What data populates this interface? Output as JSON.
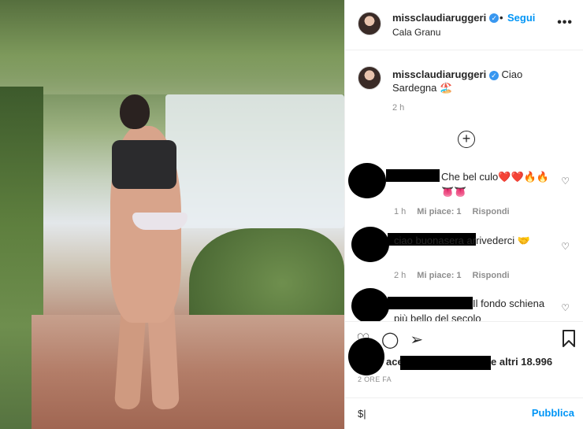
{
  "post": {
    "username": "missclaudiaruggeri",
    "follow_label": "Segui",
    "location": "Cala Granu",
    "more_icon": "more-options-icon"
  },
  "caption": {
    "username": "missclaudiaruggeri",
    "text": "Ciao Sardegna 🏖️",
    "time": "2 h"
  },
  "comments": [
    {
      "text": "Che bel culo❤️❤️🔥🔥👅👅",
      "time": "1 h",
      "likes": "Mi piace: 1",
      "reply": "Rispondi"
    },
    {
      "text": "ciao buonasera arrivederci 🤝",
      "time": "2 h",
      "likes": "Mi piace: 1",
      "reply": "Rispondi"
    },
    {
      "text": "Il fondo schiena più bello del secolo",
      "time": "",
      "likes": "",
      "reply": ""
    }
  ],
  "footer": {
    "likes_prefix": "ace",
    "likes_suffix": "e altri 18.996",
    "ago": "2 ORE FA",
    "input_value": "$|",
    "publish_label": "Pubblica"
  }
}
